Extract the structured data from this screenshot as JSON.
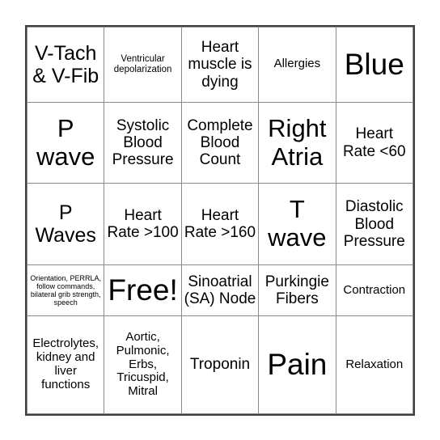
{
  "card": {
    "type": "bingo-card",
    "rows": 5,
    "columns": 5,
    "free_space": {
      "row": 4,
      "column": 2,
      "label": "Free!"
    },
    "border_color": "#3f3f3f",
    "grid_line_color": "#8a8a8a",
    "background_color": "#ffffff",
    "text_color": "#000000",
    "cells": [
      [
        {
          "text": "V-Tach & V-Fib",
          "size": "fs-l"
        },
        {
          "text": "Ventricular depolarization",
          "size": "fs-xs"
        },
        {
          "text": "Heart muscle is dying",
          "size": "fs-m"
        },
        {
          "text": "Allergies",
          "size": "fs-s"
        },
        {
          "text": "Blue",
          "size": "fs-xxl"
        }
      ],
      [
        {
          "text": "P wave",
          "size": "fs-xl"
        },
        {
          "text": "Systolic Blood Pressure",
          "size": "fs-m"
        },
        {
          "text": "Complete Blood Count",
          "size": "fs-m"
        },
        {
          "text": "Right Atria",
          "size": "fs-xl"
        },
        {
          "text": "Heart Rate <60",
          "size": "fs-m"
        }
      ],
      [
        {
          "text": "P Waves",
          "size": "fs-l"
        },
        {
          "text": "Heart Rate >100",
          "size": "fs-m"
        },
        {
          "text": "Heart Rate >160",
          "size": "fs-m"
        },
        {
          "text": "T wave",
          "size": "fs-xl"
        },
        {
          "text": "Diastolic Blood Pressure",
          "size": "fs-m"
        }
      ],
      [
        {
          "text": "Orientation, PERRLA, follow commands, bilateral grib strength, speech",
          "size": "fs-xxs"
        },
        {
          "text": "Free!",
          "size": "fs-xxl"
        },
        {
          "text": "Sinoatrial (SA) Node",
          "size": "fs-m"
        },
        {
          "text": "Purkingie Fibers",
          "size": "fs-m"
        },
        {
          "text": "Contraction",
          "size": "fs-s"
        }
      ],
      [
        {
          "text": "Electrolytes, kidney and liver functions",
          "size": "fs-s"
        },
        {
          "text": "Aortic, Pulmonic, Erbs, Tricuspid, Mitral",
          "size": "fs-s"
        },
        {
          "text": "Troponin",
          "size": "fs-m"
        },
        {
          "text": "Pain",
          "size": "fs-xxl"
        },
        {
          "text": "Relaxation",
          "size": "fs-s"
        }
      ]
    ]
  }
}
